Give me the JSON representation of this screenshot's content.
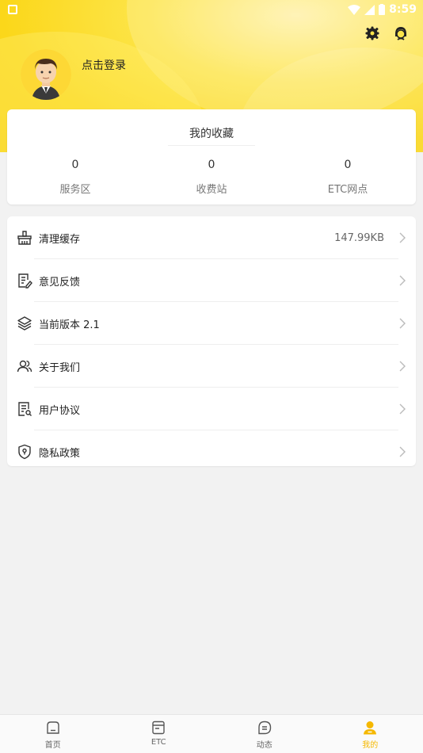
{
  "status_bar": {
    "time": "8:59"
  },
  "header": {
    "login_text": "点击登录",
    "icons": [
      "settings-gear-icon",
      "customer-service-icon"
    ]
  },
  "favorites": {
    "title": "我的收藏",
    "stats": [
      {
        "value": "0",
        "label": "服务区"
      },
      {
        "value": "0",
        "label": "收费站"
      },
      {
        "value": "0",
        "label": "ETC网点"
      }
    ]
  },
  "menu": [
    {
      "label": "清理缓存",
      "value": "147.99KB",
      "icon": "broom-icon"
    },
    {
      "label": "意见反馈",
      "value": "",
      "icon": "feedback-edit-icon"
    },
    {
      "label": "当前版本  2.1",
      "value": "",
      "icon": "layers-icon"
    },
    {
      "label": "关于我们",
      "value": "",
      "icon": "people-icon"
    },
    {
      "label": "用户协议",
      "value": "",
      "icon": "document-icon"
    },
    {
      "label": "隐私政策",
      "value": "",
      "icon": "shield-icon"
    }
  ],
  "bottom_nav": [
    {
      "label": "首页",
      "icon": "home-icon"
    },
    {
      "label": "ETC",
      "icon": "etc-card-icon"
    },
    {
      "label": "动态",
      "icon": "chat-icon"
    },
    {
      "label": "我的",
      "icon": "user-icon",
      "active": true
    }
  ],
  "colors": {
    "accent": "#f5b800",
    "header_yellow": "#fbd71a",
    "background": "#f2f2f2"
  }
}
